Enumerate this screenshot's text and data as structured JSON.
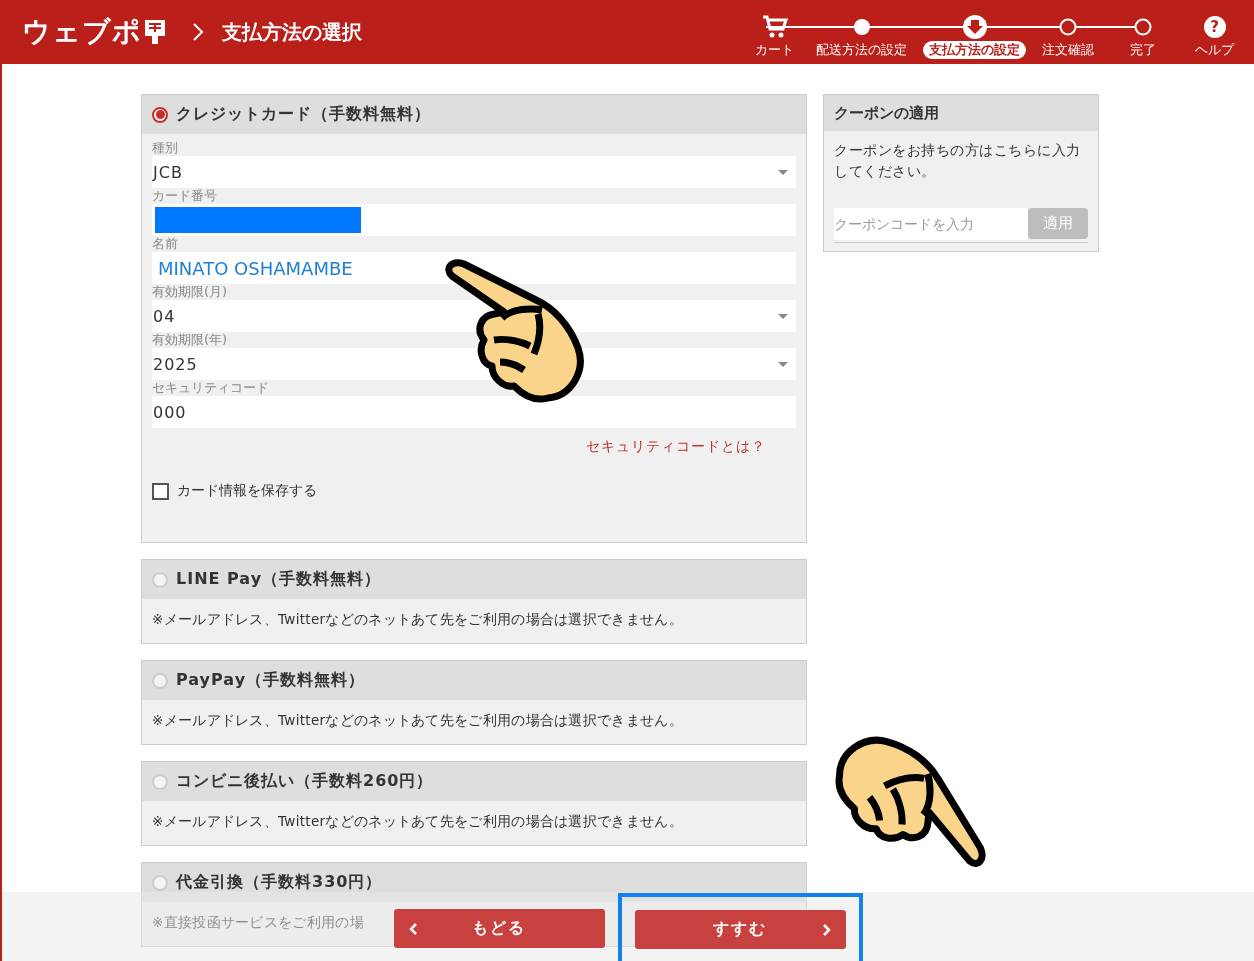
{
  "header": {
    "logo": "ウェブポ",
    "page_title": "支払方法の選択",
    "steps": [
      {
        "kind": "cart",
        "label": "カート",
        "selected": false
      },
      {
        "kind": "done",
        "label": "配送方法の設定",
        "selected": false
      },
      {
        "kind": "current",
        "label": "支払方法の設定",
        "selected": true
      },
      {
        "kind": "todo",
        "label": "注文確認",
        "selected": false
      },
      {
        "kind": "todo",
        "label": "完了",
        "selected": false
      }
    ],
    "help": {
      "glyph": "?",
      "label": "ヘルプ"
    }
  },
  "payment_methods": [
    {
      "title": "クレジットカード（手数料無料）",
      "selected": true,
      "fields": [
        {
          "kind": "select",
          "label": "種別",
          "value": "JCB"
        },
        {
          "kind": "redacted",
          "label": "カード番号"
        },
        {
          "kind": "typed",
          "label": "名前",
          "value": "MINATO OSHAMAMBE"
        },
        {
          "kind": "select",
          "label": "有効期限(月)",
          "value": "04"
        },
        {
          "kind": "select",
          "label": "有効期限(年)",
          "value": "2025"
        },
        {
          "kind": "input",
          "label": "セキュリティコード",
          "value": "000"
        }
      ],
      "help_link": "セキュリティコードとは？",
      "save_card": {
        "label": "カード情報を保存する",
        "checked": false
      }
    },
    {
      "title": "LINE Pay（手数料無料）",
      "selected": false,
      "note": "※メールアドレス、Twitterなどのネットあて先をご利用の場合は選択できません。"
    },
    {
      "title": "PayPay（手数料無料）",
      "selected": false,
      "note": "※メールアドレス、Twitterなどのネットあて先をご利用の場合は選択できません。"
    },
    {
      "title": "コンビニ後払い（手数料260円）",
      "selected": false,
      "note": "※メールアドレス、Twitterなどのネットあて先をご利用の場合は選択できません。"
    },
    {
      "title": "代金引換（手数料330円）",
      "selected": false,
      "note": "※直接投函サービスをご利用の場"
    }
  ],
  "coupon": {
    "title": "クーポンの適用",
    "description": "クーポンをお持ちの方はこちらに入力してください。",
    "placeholder": "クーポンコードを入力",
    "apply": "適用"
  },
  "footer": {
    "back": "もどる",
    "next": "すすむ",
    "next_highlighted": true
  }
}
